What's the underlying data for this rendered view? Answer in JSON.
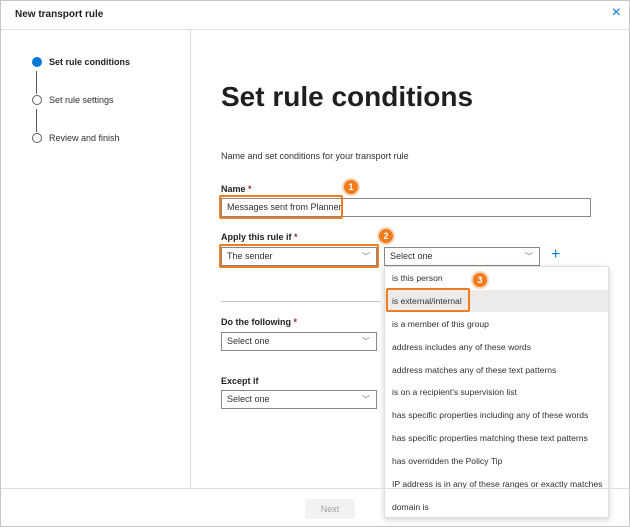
{
  "header": {
    "title": "New transport rule",
    "close_icon": "×"
  },
  "steps": [
    {
      "label": "Set rule conditions",
      "active": true
    },
    {
      "label": "Set rule settings",
      "active": false
    },
    {
      "label": "Review and finish",
      "active": false
    }
  ],
  "main": {
    "title": "Set rule conditions",
    "subtitle": "Name and set conditions for your transport rule",
    "name_label": "Name",
    "name_value": "Messages sent from Planner",
    "apply_label": "Apply this rule if",
    "apply_value": "The sender",
    "apply_second_value": "Select one",
    "do_label": "Do the following",
    "do_value": "Select one",
    "except_label": "Except if",
    "except_value": "Select one",
    "required_mark": "*",
    "plus_icon": "+",
    "chevron": "﹀"
  },
  "menu": {
    "items": [
      "is this person",
      "is external/internal",
      "is a member of this group",
      "address includes any of these words",
      "address matches any of these text patterns",
      "is on a recipient's supervision list",
      "has specific properties including any of these words",
      "has specific properties matching these text patterns",
      "has overridden the Policy Tip",
      "IP address is in any of these ranges or exactly matches",
      "domain is"
    ],
    "selected_index": 1
  },
  "badges": [
    "1",
    "2",
    "3"
  ],
  "footer": {
    "next_label": "Next"
  },
  "colors": {
    "accent": "#0078d4",
    "highlight": "#f07c1d",
    "required": "#a4262c"
  }
}
